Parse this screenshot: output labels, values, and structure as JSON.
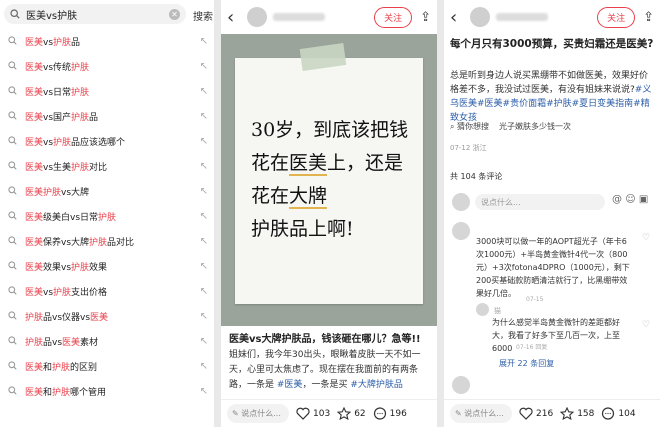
{
  "search": {
    "query": "医美vs护肤",
    "button": "搜索",
    "suggestions": [
      "医美vs护肤品",
      "医美vs传统护肤",
      "医美vs日常护肤",
      "医美vs国产护肤品",
      "医美vs护肤品应该选哪个",
      "医美vs生美护肤对比",
      "医美护肤vs大牌",
      "医美级美白vs日常护肤",
      "医美保养vs大牌护肤品对比",
      "医美效果vs护肤效果",
      "医美vs护肤支出价格",
      "护肤品vs仪器vs医美",
      "护肤品vs医美素材",
      "医美和护肤的区别",
      "医美和护肤哪个管用"
    ]
  },
  "post1": {
    "follow": "关注",
    "image_lines": [
      "30岁，到底该把钱",
      "花在医美上，还是",
      "花在大牌",
      "护肤品上啊!"
    ],
    "title": "医美vs大牌护肤品，钱该砸在哪儿？急等!!",
    "body": "姐妹们，我今年30出头，眼瞅着皮肤一天不如一天，心里可太焦虑了。现在摆在我面前的有两条路，一条是",
    "tag1": "#医美",
    "body2": "，一条是买",
    "tag2": "#大牌护肤品",
    "comment_placeholder": "说点什么...",
    "likes": "103",
    "stars": "62",
    "comments": "196"
  },
  "post2": {
    "follow": "关注",
    "title": "每个月只有3000预算，买贵妇霜还是医美?",
    "body": "总是听到身边人说买黑绷带不如做医美，效果好价格差不多，我没试过医美，有没有姐妹来说说?",
    "tags": "#义乌医美#医美#贵价面霜#护肤#夏日变美指南#精致女孩",
    "related": [
      "猜你想搜",
      "光子嫩肤多少钱一次"
    ],
    "date": "07-12 浙江",
    "comment_count": "共 104 条评论",
    "comment_placeholder": "说点什么...",
    "comment1": "3000块可以做一年的AOPT超光子（年卡6次1000元）+半岛黄金微针4代一次（800元）+3次fotona4DPRO（1000元），剩下200买基础款防晒清洁就行了，比黑绷带效果好几倍。",
    "comment1_meta": "07-15",
    "reply_user": "猫",
    "reply": "为什么感觉半岛黄金微针的差距都好大，我看了好多下至几百一次，上至6000",
    "reply_meta": "07-16 回复",
    "expand": "展开 22 条回复",
    "likes": "216",
    "stars": "158",
    "comments": "104"
  },
  "colors": {
    "accent": "#e8414b",
    "link": "#2c5ea8"
  }
}
